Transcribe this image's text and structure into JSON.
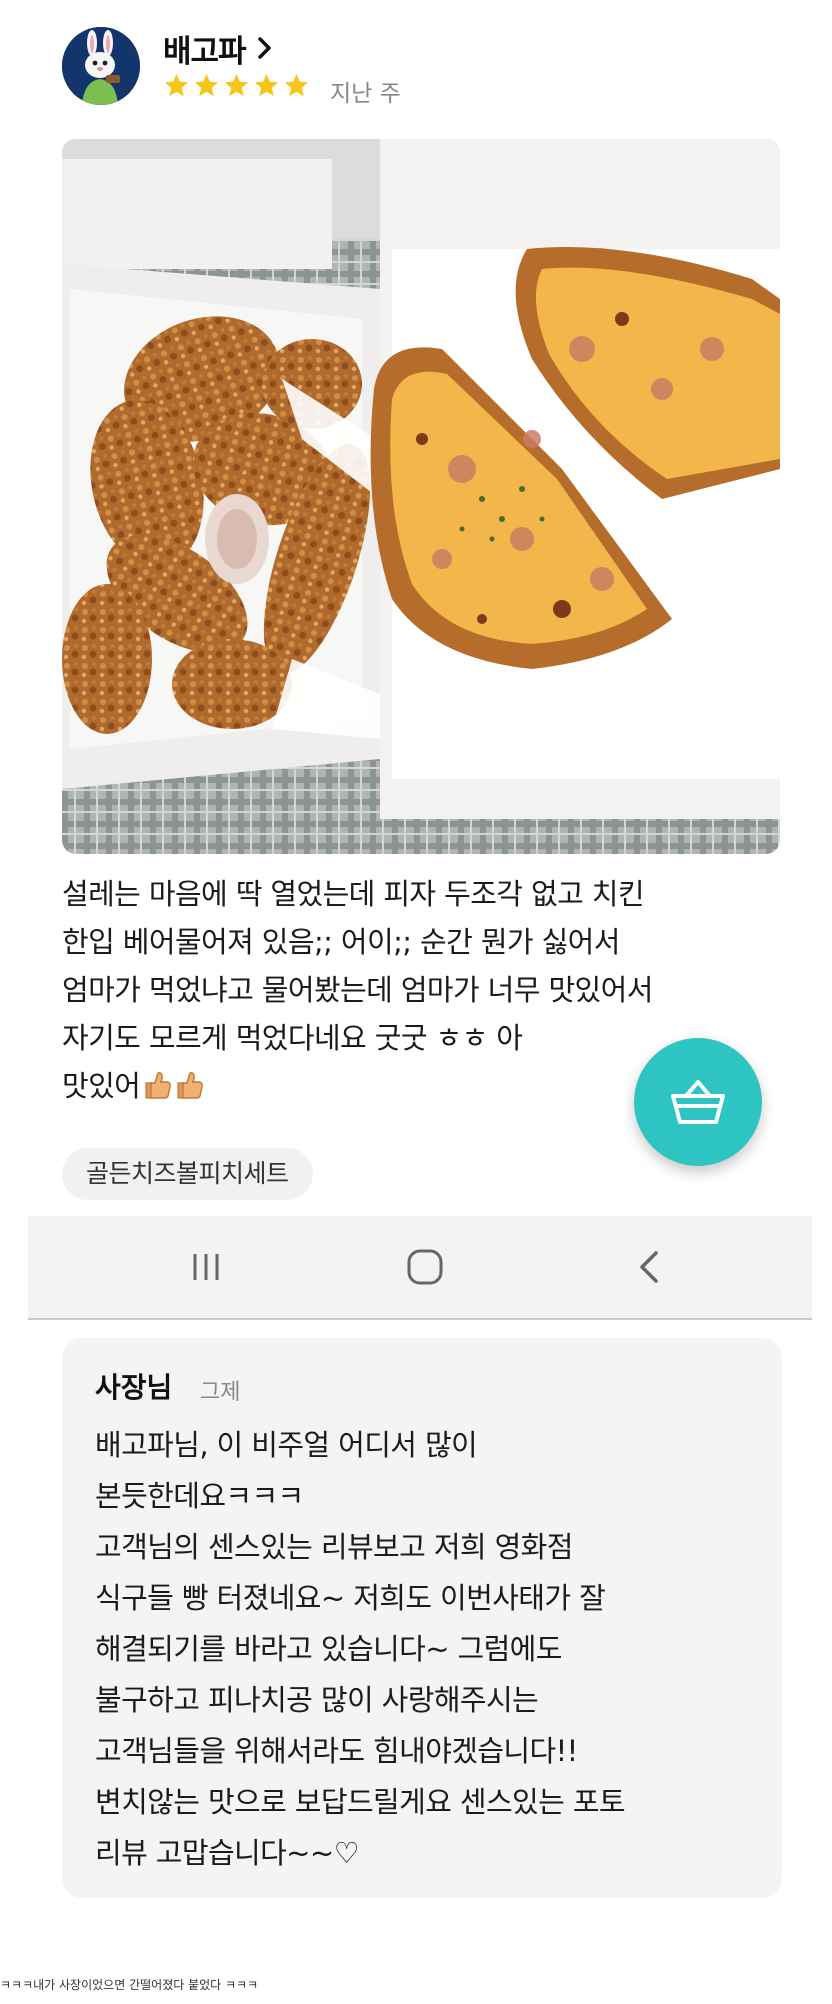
{
  "review": {
    "nickname": "배고파",
    "rating": 5,
    "date": "지난 주",
    "text_lines": [
      "설레는 마음에 딱 열었는데 피자 두조각 없고 치킨",
      "한입 베어물어져 있음;; 어이;; 순간 뭔가 싫어서",
      "엄마가 먹었냐고 물어봤는데 엄마가 너무 맛있어서",
      "자기도 모르게 먹었다네요 굿굿 ㅎㅎ 아",
      "맛있어"
    ],
    "menu_tag": "골든치즈볼피치세트"
  },
  "owner_reply": {
    "author": "사장님",
    "date": "그제",
    "text_lines": [
      "배고파님, 이 비주얼 어디서 많이",
      "본듯한데요ㅋㅋㅋ",
      "고객님의 센스있는 리뷰보고 저희 영화점",
      "식구들  빵 터졌네요~ 저희도 이번사태가 잘",
      "해결되기를 바라고 있습니다~ 그럼에도",
      "불구하고 피나치공 많이 사랑해주시는",
      "고객님들을 위해서라도 힘내야겠습니다!!",
      "변치않는 맛으로 보답드릴게요 센스있는 포토",
      "리뷰 고맙습니다~~♡"
    ]
  },
  "caption": "ㅋㅋㅋ내가 사장이었으면 간떨어졌다 붙었다 ㅋㅋㅋ",
  "icons": {
    "avatar": "bunny-mascot-avatar",
    "nickname_chevron": "chevron-right-icon",
    "star": "star-icon",
    "cart": "shopping-basket-icon",
    "nav_recents": "recents-icon",
    "nav_home": "home-icon",
    "nav_back": "back-icon",
    "thumbs": "thumbs-up-emoji"
  },
  "colors": {
    "star": "#f5c518",
    "fab": "#2ec4c2",
    "owner_box": "#f4f4f4",
    "date_gray": "#888888"
  }
}
